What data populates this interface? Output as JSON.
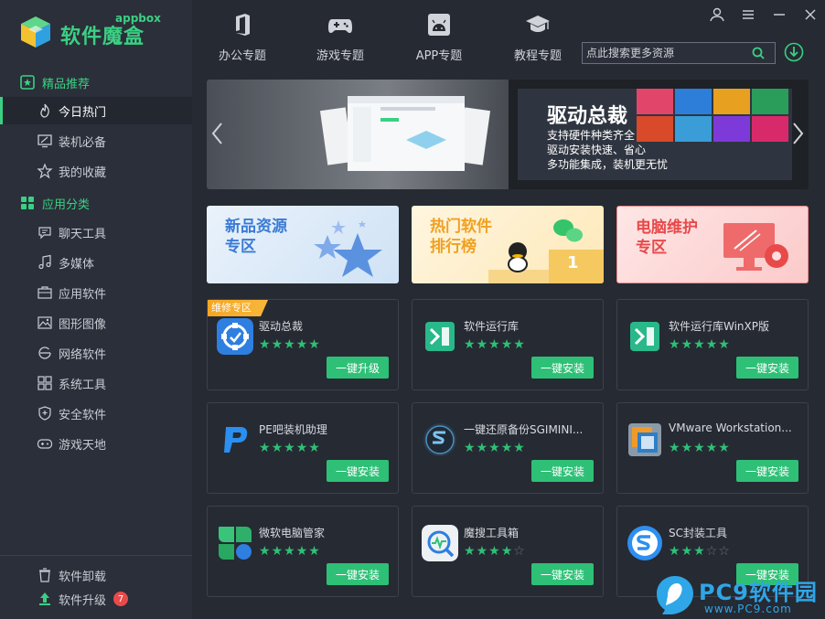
{
  "app": {
    "logo_text": "软件魔盒",
    "logo_sub": "appbox"
  },
  "sidebar": {
    "sections": [
      {
        "label": "精品推荐"
      },
      {
        "label": "应用分类"
      }
    ],
    "recommend": [
      {
        "label": "今日热门",
        "icon": "fire-icon"
      },
      {
        "label": "装机必备",
        "icon": "monitor-icon"
      },
      {
        "label": "我的收藏",
        "icon": "star-icon"
      }
    ],
    "categories": [
      {
        "label": "聊天工具",
        "icon": "chat-icon"
      },
      {
        "label": "多媒体",
        "icon": "music-icon"
      },
      {
        "label": "应用软件",
        "icon": "briefcase-icon"
      },
      {
        "label": "图形图像",
        "icon": "image-icon"
      },
      {
        "label": "网络软件",
        "icon": "browser-icon"
      },
      {
        "label": "系统工具",
        "icon": "grid-icon"
      },
      {
        "label": "安全软件",
        "icon": "shield-icon"
      },
      {
        "label": "游戏天地",
        "icon": "gamepad-icon"
      }
    ],
    "bottom": [
      {
        "label": "软件卸载",
        "icon": "trash-icon"
      },
      {
        "label": "软件升级",
        "icon": "upgrade-icon",
        "badge": "7"
      }
    ]
  },
  "topnav": [
    {
      "label": "办公专题",
      "icon": "office-icon"
    },
    {
      "label": "游戏专题",
      "icon": "gamepad-icon"
    },
    {
      "label": "APP专题",
      "icon": "android-icon"
    },
    {
      "label": "教程专题",
      "icon": "graduation-cap-icon"
    }
  ],
  "search": {
    "placeholder": "点此搜索更多资源"
  },
  "banner": {
    "title": "驱动总裁",
    "lines": [
      "支持硬件种类齐全",
      "驱动安装快速、省心",
      "多功能集成，装机更无忧"
    ]
  },
  "promos": [
    {
      "title_line1": "新品资源",
      "title_line2": "专区",
      "color": "#3a7bd5"
    },
    {
      "title_line1": "热门软件",
      "title_line2": "排行榜",
      "color": "#f0a020",
      "rank": "1"
    },
    {
      "title_line1": "电脑维护",
      "title_line2": "专区",
      "color": "#e84a4a"
    }
  ],
  "apps": [
    {
      "name": "驱动总裁",
      "rating": 5,
      "button": "一键升级",
      "ribbon": "维修专区"
    },
    {
      "name": "软件运行库",
      "rating": 5,
      "button": "一键安装"
    },
    {
      "name": "软件运行库WinXP版",
      "rating": 5,
      "button": "一键安装"
    },
    {
      "name": "PE吧装机助理",
      "rating": 5,
      "button": "一键安装"
    },
    {
      "name": "一键还原备份SGIMINI...",
      "rating": 5,
      "button": "一键安装"
    },
    {
      "name": "VMware Workstation...",
      "rating": 5,
      "button": "一键安装"
    },
    {
      "name": "微软电脑管家",
      "rating": 5,
      "button": "一键安装"
    },
    {
      "name": "魔搜工具箱",
      "rating": 4,
      "button": "一键安装"
    },
    {
      "name": "SC封装工具",
      "rating": 3,
      "button": "一键安装"
    }
  ],
  "watermark": {
    "brand": "PC9软件园",
    "url": "www.PC9.com"
  },
  "colors": {
    "accent": "#3ad083",
    "button": "#2ec076",
    "star": "#2ec076"
  }
}
